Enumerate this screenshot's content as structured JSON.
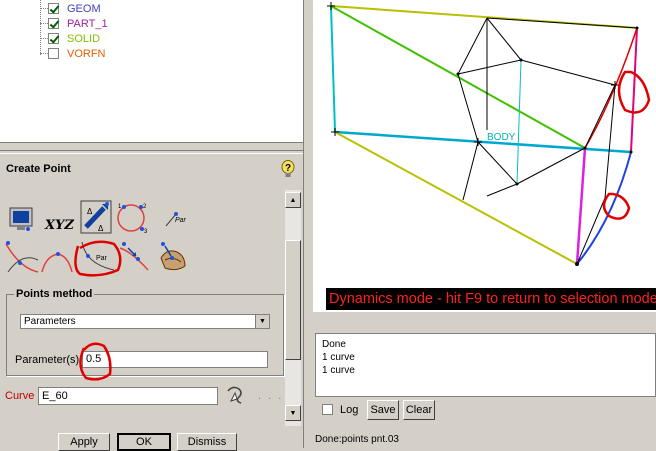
{
  "tree": {
    "items": [
      {
        "label": "GEOM",
        "checked": true,
        "color": "#4040c0"
      },
      {
        "label": "PART_1",
        "checked": true,
        "color": "#a020a0"
      },
      {
        "label": "SOLID",
        "checked": true,
        "color": "#80c000"
      },
      {
        "label": "VORFN",
        "checked": false,
        "color": "#e06000"
      }
    ]
  },
  "panel": {
    "title": "Create Point",
    "help_icon": "question-lightbulb-icon",
    "icon_xyz_label": "XYZ",
    "par_label": "Par",
    "par_label2": "Par",
    "points_method": {
      "legend": "Points method",
      "selected": "Parameters",
      "param_label": "Parameter(s)",
      "param_value": "0.5"
    },
    "curve_label": "Curve",
    "curve_value": "E_60",
    "browse_dots": ". . ."
  },
  "buttons": {
    "apply": "Apply",
    "ok": "OK",
    "dismiss": "Dismiss"
  },
  "viewport": {
    "body_label": "BODY",
    "banner": "Dynamics mode - hit F9 to return to selection mode"
  },
  "log": {
    "lines": [
      "Done",
      "1 curve",
      "1 curve"
    ],
    "log_checkbox_label": "Log",
    "save": "Save",
    "clear": "Clear"
  },
  "status": "Done:points pnt.03"
}
